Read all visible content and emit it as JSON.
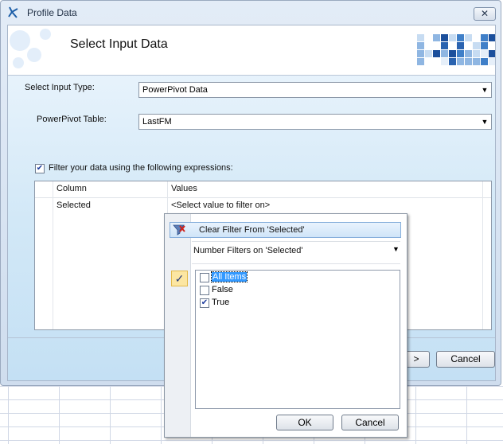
{
  "window": {
    "title": "Profile Data",
    "close_label": "✕"
  },
  "header": {
    "title": "Select Input Data"
  },
  "form": {
    "input_type_label": "Select Input Type:",
    "input_type_value": "PowerPivot Data",
    "table_label": "PowerPivot Table:",
    "table_value": "LastFM",
    "filter_checkbox_checked": true,
    "filter_label": "Filter your data  using the following expressions:"
  },
  "grid": {
    "columns": [
      "Column",
      "Values"
    ],
    "rows": [
      {
        "column": "Selected",
        "values": "<Select value to filter on>"
      }
    ]
  },
  "dialog_buttons": {
    "next_partial": ">",
    "cancel": "Cancel"
  },
  "filter_popup": {
    "clear_filter": "Clear Filter From 'Selected'",
    "number_filters": "Number Filters on 'Selected'",
    "submenu_arrow": "▸",
    "items": [
      {
        "label": "All Items",
        "checked": false,
        "highlighted": true
      },
      {
        "label": "False",
        "checked": false,
        "highlighted": false
      },
      {
        "label": "True",
        "checked": true,
        "highlighted": false
      }
    ],
    "ok": "OK",
    "cancel": "Cancel"
  },
  "colors": {
    "accent": "#1d5fa8",
    "highlight": "#3399ff",
    "checkmark_bg": "#fce6a2"
  }
}
